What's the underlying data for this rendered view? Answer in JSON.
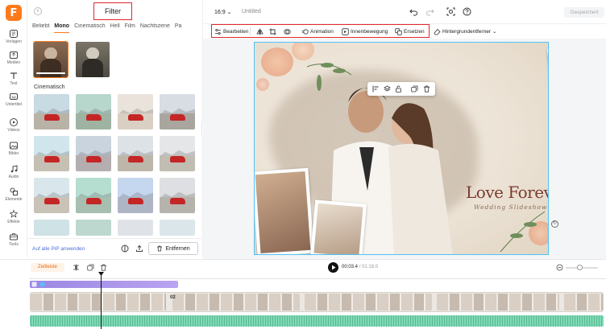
{
  "app": {
    "logo_letter": "F",
    "ratio": "16:9",
    "doc_title": "Untitled",
    "saved_label": "Gespeichert"
  },
  "rail": [
    {
      "label": "Vorlagen",
      "icon": "home-icon"
    },
    {
      "label": "Medien",
      "icon": "upload-icon"
    },
    {
      "label": "Text",
      "icon": "text-icon"
    },
    {
      "label": "Untertitel",
      "icon": "subtitle-icon"
    },
    {
      "label": "Videos",
      "icon": "video-icon"
    },
    {
      "label": "Bilder",
      "icon": "image-icon"
    },
    {
      "label": "Audio",
      "icon": "music-icon"
    },
    {
      "label": "Elemente",
      "icon": "shapes-icon"
    },
    {
      "label": "Effekte",
      "icon": "effects-icon"
    },
    {
      "label": "Tools",
      "icon": "toolbox-icon"
    }
  ],
  "panel": {
    "title": "Filter",
    "tabs": [
      "Beliebt",
      "Mono",
      "Cinematisch",
      "Hell",
      "Film",
      "Nachtszene",
      "Pa"
    ],
    "active_tab": "Mono",
    "section_title": "Cinematisch",
    "apply_link": "Auf alle PiP anwenden",
    "remove_label": "Entfernen"
  },
  "toolbar": {
    "edit_label": "Bearbeiten",
    "animation_label": "Animation",
    "inner_motion_label": "Innenbewegung",
    "replace_label": "Ersetzen",
    "bg_remover_label": "Hintergrundentferner"
  },
  "canvas": {
    "title_text": "Love Forever",
    "subtitle_text": "Wedding Slideshow"
  },
  "timeline": {
    "zeitleiste_label": "Zeitleiste",
    "current_time": "00:03.4",
    "total_time": "/ 01:18.0",
    "clip_marker": "02"
  },
  "colors": {
    "accent": "#ff7a1a",
    "highlight_box": "#e0282c",
    "selection": "#4fc3f7"
  }
}
